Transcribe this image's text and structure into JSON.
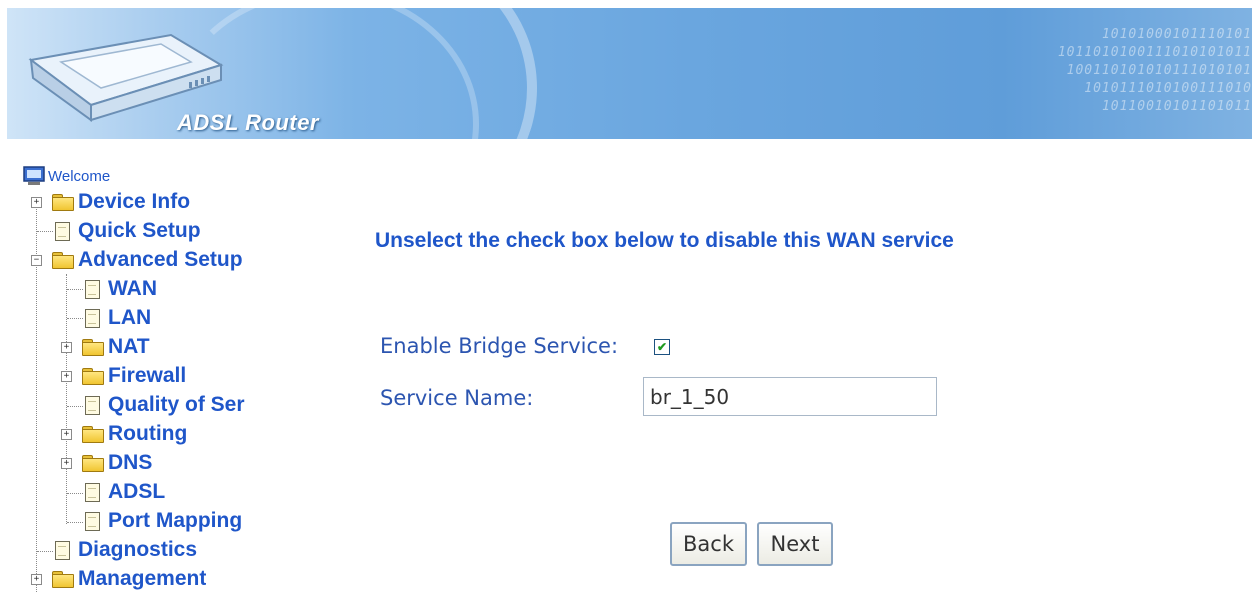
{
  "banner": {
    "brand": "ADSL Router",
    "binary_lines": [
      "10101000101110101",
      "1011010100111010101011",
      "100110101010111010101",
      "1010111010100111010",
      "10110010101101011"
    ]
  },
  "nav": {
    "welcome": "Welcome",
    "items": [
      {
        "label": "Device Info"
      },
      {
        "label": "Quick Setup"
      },
      {
        "label": "Advanced Setup"
      },
      {
        "label": "WAN"
      },
      {
        "label": "LAN"
      },
      {
        "label": "NAT"
      },
      {
        "label": "Firewall"
      },
      {
        "label": "Quality of Ser"
      },
      {
        "label": "Routing"
      },
      {
        "label": "DNS"
      },
      {
        "label": "ADSL"
      },
      {
        "label": "Port Mapping"
      },
      {
        "label": "Diagnostics"
      },
      {
        "label": "Management"
      }
    ]
  },
  "main": {
    "heading": "Unselect the check box below to disable this WAN service",
    "enable_label": "Enable Bridge Service:",
    "enable_checked": true,
    "service_name_label": "Service Name:",
    "service_name_value": "br_1_50",
    "back_label": "Back",
    "next_label": "Next"
  },
  "icons": {
    "welcome": "computer-icon",
    "expandable": "folder-icon",
    "page": "document-icon",
    "expander": "plus-minus-icon"
  },
  "colors": {
    "link_blue": "#1f56c9",
    "banner_blue": "#6aa6df",
    "check_green": "#1f9a1f"
  }
}
